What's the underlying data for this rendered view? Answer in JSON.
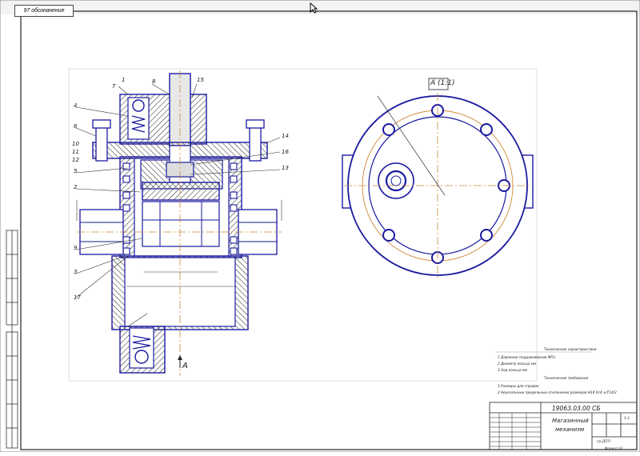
{
  "sheet": {
    "top_tab_label": "97 обозначение",
    "section_label": "А (1:1)",
    "view_label": "А",
    "title_block": {
      "designation": "19063.03.00 СБ",
      "name_line1": "Магазинный",
      "name_line2": "механизм",
      "scale": "1:1",
      "group": "гр.ДПЛ",
      "format": "Формат А1"
    },
    "tech_chars_title": "Технические характеристики",
    "tech_chars": [
      "1 Давление поддавливания  МПа",
      "2 Диаметр кольца   мм",
      "3 Ход кольца   мм"
    ],
    "tech_req_title": "Технические требования",
    "tech_req": [
      "1 Размеры для справок",
      "2 Неуказанные предельные отклонения размеров  Н14  h14  ±IT14/2"
    ],
    "part_numbers": [
      "1",
      "2",
      "3",
      "4",
      "5",
      "6",
      "7",
      "8",
      "9",
      "10",
      "11",
      "12",
      "13",
      "14",
      "15",
      "16",
      "17"
    ]
  }
}
